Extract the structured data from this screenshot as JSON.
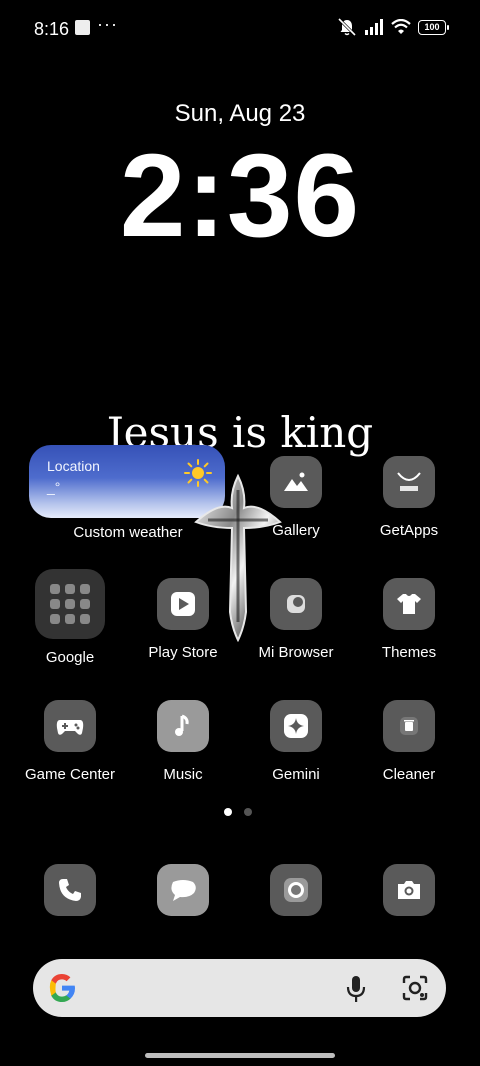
{
  "status_bar": {
    "time": "8:16",
    "dots": "···",
    "battery": "100"
  },
  "lockclock": {
    "date": "Sun, Aug 23",
    "time": "2:36"
  },
  "wallpaper": {
    "text": "Jesus is king"
  },
  "weather_widget": {
    "location": "Location",
    "temp": "_°",
    "label": "Custom weather"
  },
  "apps": [
    {
      "label": "Gallery",
      "icon": "gallery-icon"
    },
    {
      "label": "GetApps",
      "icon": "getapps-icon"
    },
    {
      "label": "Google",
      "icon": "google-folder-icon"
    },
    {
      "label": "Play Store",
      "icon": "play-store-icon"
    },
    {
      "label": "Mi Browser",
      "icon": "browser-icon"
    },
    {
      "label": "Themes",
      "icon": "themes-icon"
    },
    {
      "label": "Game Center",
      "icon": "gamepad-icon"
    },
    {
      "label": "Music",
      "icon": "music-icon"
    },
    {
      "label": "Gemini",
      "icon": "gemini-icon"
    },
    {
      "label": "Cleaner",
      "icon": "trash-icon"
    }
  ],
  "dock": [
    {
      "icon": "phone-icon"
    },
    {
      "icon": "messages-icon"
    },
    {
      "icon": "chrome-icon"
    },
    {
      "icon": "camera-icon"
    }
  ],
  "pages": {
    "count": 2,
    "active": 1
  },
  "colors": {
    "background": "#000000",
    "icon_bg": "#5a5a5a",
    "widget_blue": "#3652b7",
    "search_bg": "#e6e6e6"
  }
}
